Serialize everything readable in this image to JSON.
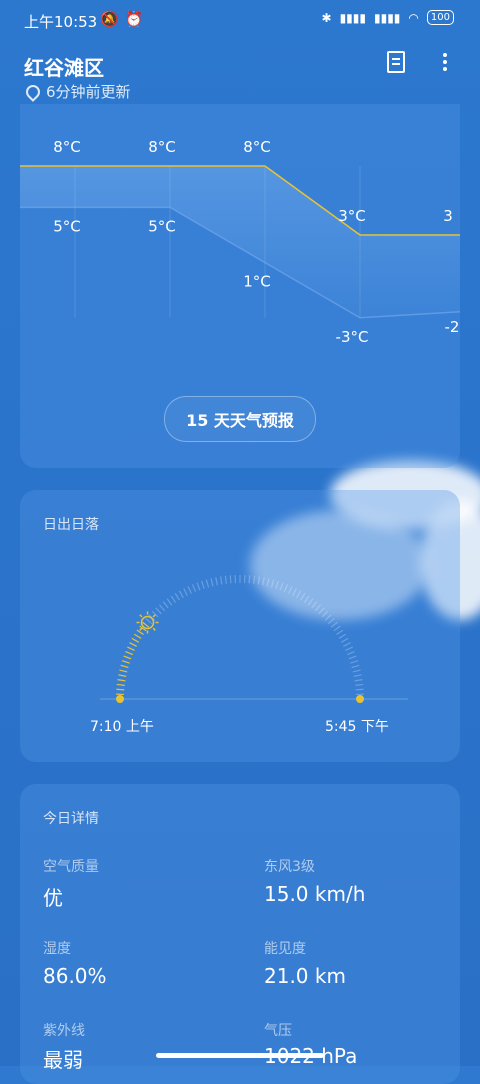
{
  "status_bar": {
    "time": "上午10:53",
    "battery": "100"
  },
  "header": {
    "location": "红谷滩区",
    "updated": "6分钟前更新"
  },
  "chart_data": {
    "type": "line",
    "series": [
      {
        "values": [
          8,
          8,
          8,
          3
        ]
      },
      {
        "values": [
          5,
          5,
          1,
          -3
        ]
      }
    ],
    "high_labels": [
      "8°C",
      "8°C",
      "8°C",
      "3°C",
      "3"
    ],
    "low_labels": [
      "5°C",
      "5°C",
      "1°C",
      "-3°C",
      "-2"
    ],
    "line_color": "#e9c234"
  },
  "forecast_button": "15 天天气预报",
  "sun": {
    "title": "日出日落",
    "sunrise": "7:10 上午",
    "sunset": "5:45 下午",
    "progress": 0.22
  },
  "details": {
    "title": "今日详情",
    "items": [
      {
        "label": "空气质量",
        "value": "优"
      },
      {
        "label": "东风3级",
        "value": "15.0 km/h"
      },
      {
        "label": "湿度",
        "value": "86.0%"
      },
      {
        "label": "能见度",
        "value": "21.0 km"
      },
      {
        "label": "紫外线",
        "value": "最弱"
      },
      {
        "label": "气压",
        "value": "1022 hPa"
      }
    ]
  }
}
